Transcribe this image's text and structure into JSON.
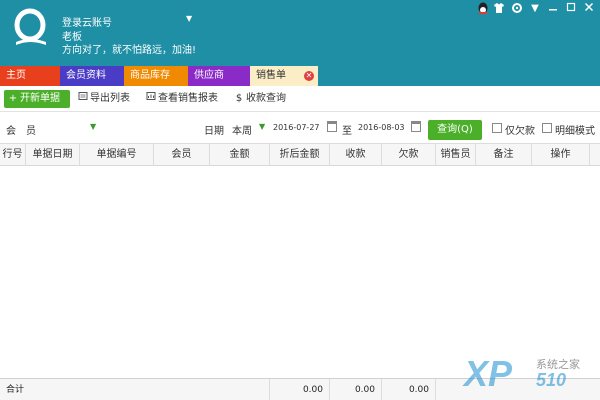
{
  "header": {
    "account_label": "登录云账号",
    "user_name": "老板",
    "slogan": "方向对了，就不怕路远，加油!",
    "bg_color": "#1e8fa4"
  },
  "tabs": [
    {
      "label": "主页",
      "color": "#e8401c"
    },
    {
      "label": "会员资料",
      "color": "#4b3cc6"
    },
    {
      "label": "商品库存",
      "color": "#f08a00"
    },
    {
      "label": "供应商",
      "color": "#8a2bc8"
    },
    {
      "label": "销售单",
      "color": "#fbeec6",
      "active": true
    }
  ],
  "toolbar": {
    "new_order": "开新单据",
    "export_list": "导出列表",
    "view_report": "查看销售报表",
    "collect_query": "收款查询"
  },
  "filter": {
    "member_label": "会　员",
    "date_label": "日期",
    "period": "本周",
    "date_from": "2016-07-27",
    "to_label": "至",
    "date_to": "2016-08-03",
    "query_button": "查询(Q)",
    "owed_only": "仅欠款",
    "detail_mode": "明细模式"
  },
  "table": {
    "columns": [
      "行号",
      "单据日期",
      "单据编号",
      "会员",
      "金额",
      "折后金额",
      "收款",
      "欠款",
      "销售员",
      "备注",
      "操作"
    ]
  },
  "footer": {
    "total_label": "合计",
    "discounted_total": "0.00",
    "received_total": "0.00",
    "owed_total": "0.00"
  },
  "watermark": {
    "brand": "XP",
    "site_name": "系统之家",
    "site_num": "510"
  }
}
